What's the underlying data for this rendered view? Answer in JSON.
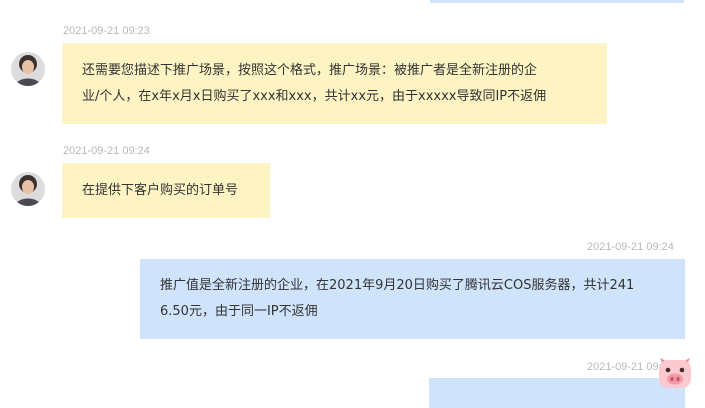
{
  "messages": [
    {
      "side": "agent",
      "time": "2021-09-21 09:23",
      "lines": [
        "还需要您描述下推广场景，按照这个格式，推广场景：被推广者是全新注册的企",
        "业/个人，在x年x月x日购买了xxx和xxx，共计xx元，由于xxxxx导致同IP不返佣"
      ]
    },
    {
      "side": "agent",
      "time": "2021-09-21 09:24",
      "lines": [
        "在提供下客户购买的订单号"
      ]
    },
    {
      "side": "user",
      "time": "2021-09-21 09:24",
      "lines": [
        "推广值是全新注册的企业，在2021年9月20日购买了腾讯云COS服务器，共计241",
        "6.50元，由于同一IP不返佣"
      ]
    },
    {
      "side": "user",
      "time": "2021-09-21 09:"
    }
  ],
  "icons": {
    "agent_avatar": "agent-avatar",
    "assistant_widget": "pig-face-icon"
  },
  "colors": {
    "agent_bubble": "#fdf3c3",
    "user_bubble": "#cfe3fb",
    "timestamp": "#b9b9b9"
  }
}
